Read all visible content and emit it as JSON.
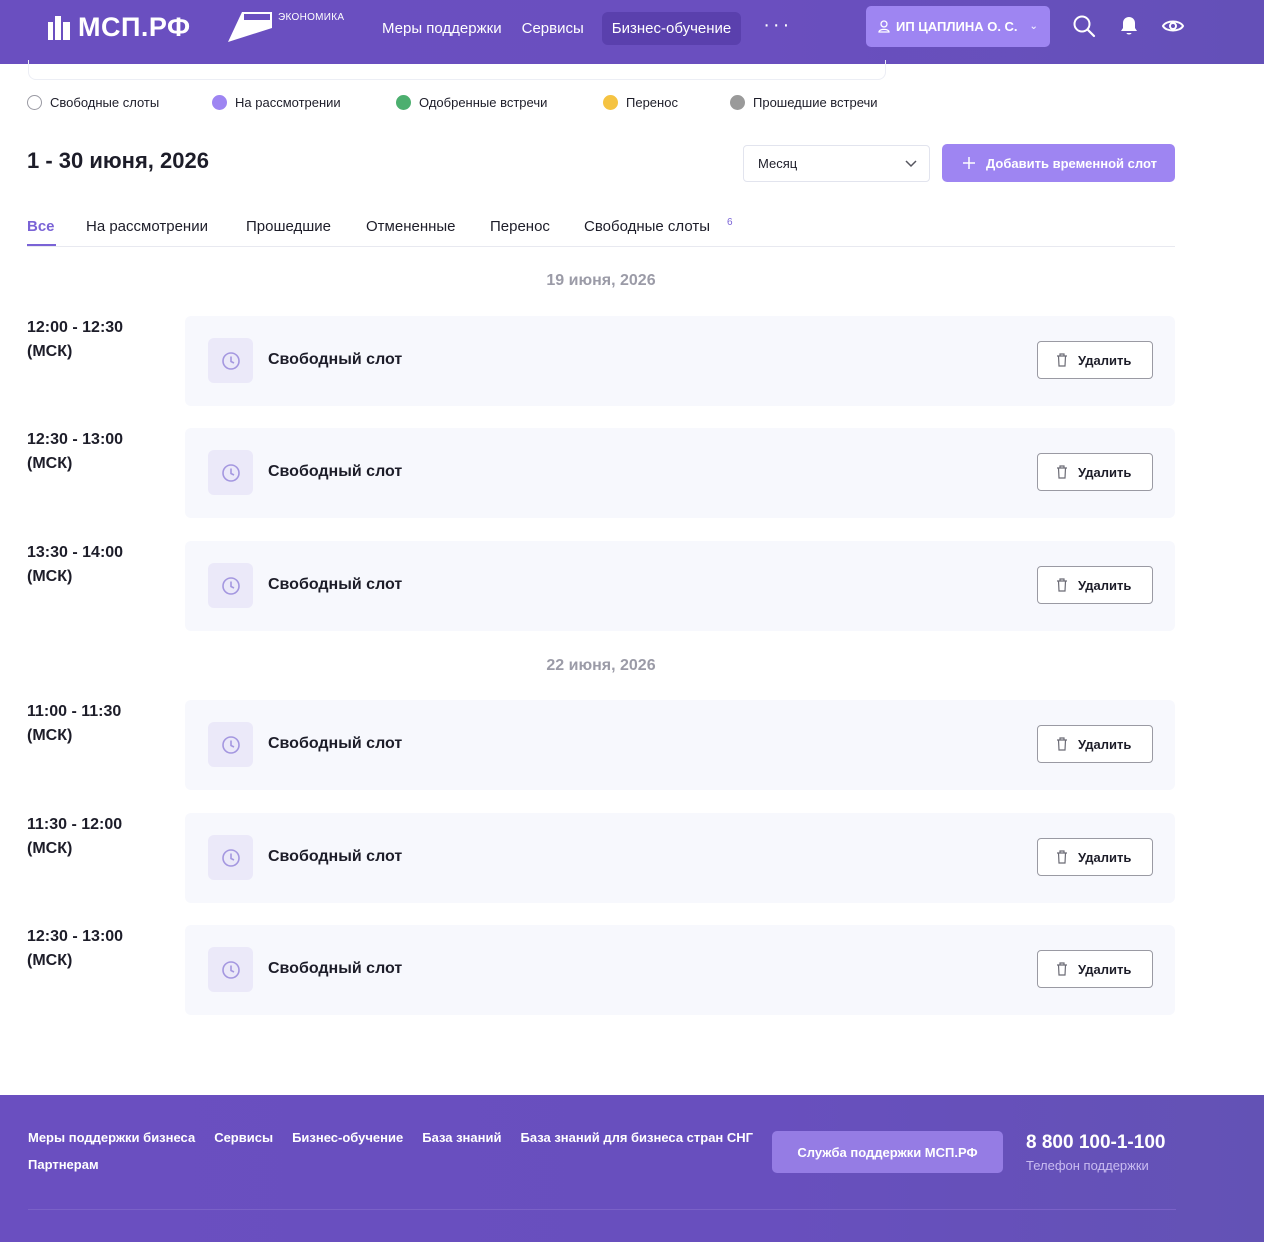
{
  "header": {
    "logo": "МСП.РФ",
    "eco_label": "ЭКОНОМИКА",
    "nav": [
      "Меры поддержки",
      "Сервисы",
      "Бизнес-обучение"
    ],
    "more": "···",
    "user": "ИП ЦАПЛИНА О. С."
  },
  "legend": [
    {
      "label": "Свободные слоты",
      "color": "#ffffff"
    },
    {
      "label": "На рассмотрении",
      "color": "#9e85f2"
    },
    {
      "label": "Одобренные встречи",
      "color": "#4caf6f"
    },
    {
      "label": "Перенос",
      "color": "#f5c342"
    },
    {
      "label": "Прошедшие встречи",
      "color": "#9a9a9a"
    }
  ],
  "period": "1 - 30 июня, 2026",
  "select": {
    "value": "Месяц"
  },
  "add_button": "Добавить временной слот",
  "tabs": [
    "Все",
    "На рассмотрении",
    "Прошедшие",
    "Отмененные",
    "Перенос",
    "Свободные слоты"
  ],
  "tab_badge": "6",
  "groups": [
    {
      "date": "19 июня, 2026",
      "slots": [
        {
          "time": "12:00 - 12:30",
          "tz": "(МСК)",
          "title": "Свободный слот",
          "action": "Удалить"
        },
        {
          "time": "12:30 - 13:00",
          "tz": "(МСК)",
          "title": "Свободный слот",
          "action": "Удалить"
        },
        {
          "time": "13:30 - 14:00",
          "tz": "(МСК)",
          "title": "Свободный слот",
          "action": "Удалить"
        }
      ]
    },
    {
      "date": "22 июня, 2026",
      "slots": [
        {
          "time": "11:00 - 11:30",
          "tz": "(МСК)",
          "title": "Свободный слот",
          "action": "Удалить"
        },
        {
          "time": "11:30 - 12:00",
          "tz": "(МСК)",
          "title": "Свободный слот",
          "action": "Удалить"
        },
        {
          "time": "12:30 - 13:00",
          "tz": "(МСК)",
          "title": "Свободный слот",
          "action": "Удалить"
        }
      ]
    }
  ],
  "footer": {
    "links": [
      "Меры поддержки бизнеса",
      "Сервисы",
      "Бизнес-обучение",
      "База знаний",
      "База знаний для бизнеса стран СНГ",
      "Партнерам"
    ],
    "support": "Служба поддержки МСП.РФ",
    "phone": "8 800 100-1-100",
    "phone_label": "Телефон поддержки"
  }
}
